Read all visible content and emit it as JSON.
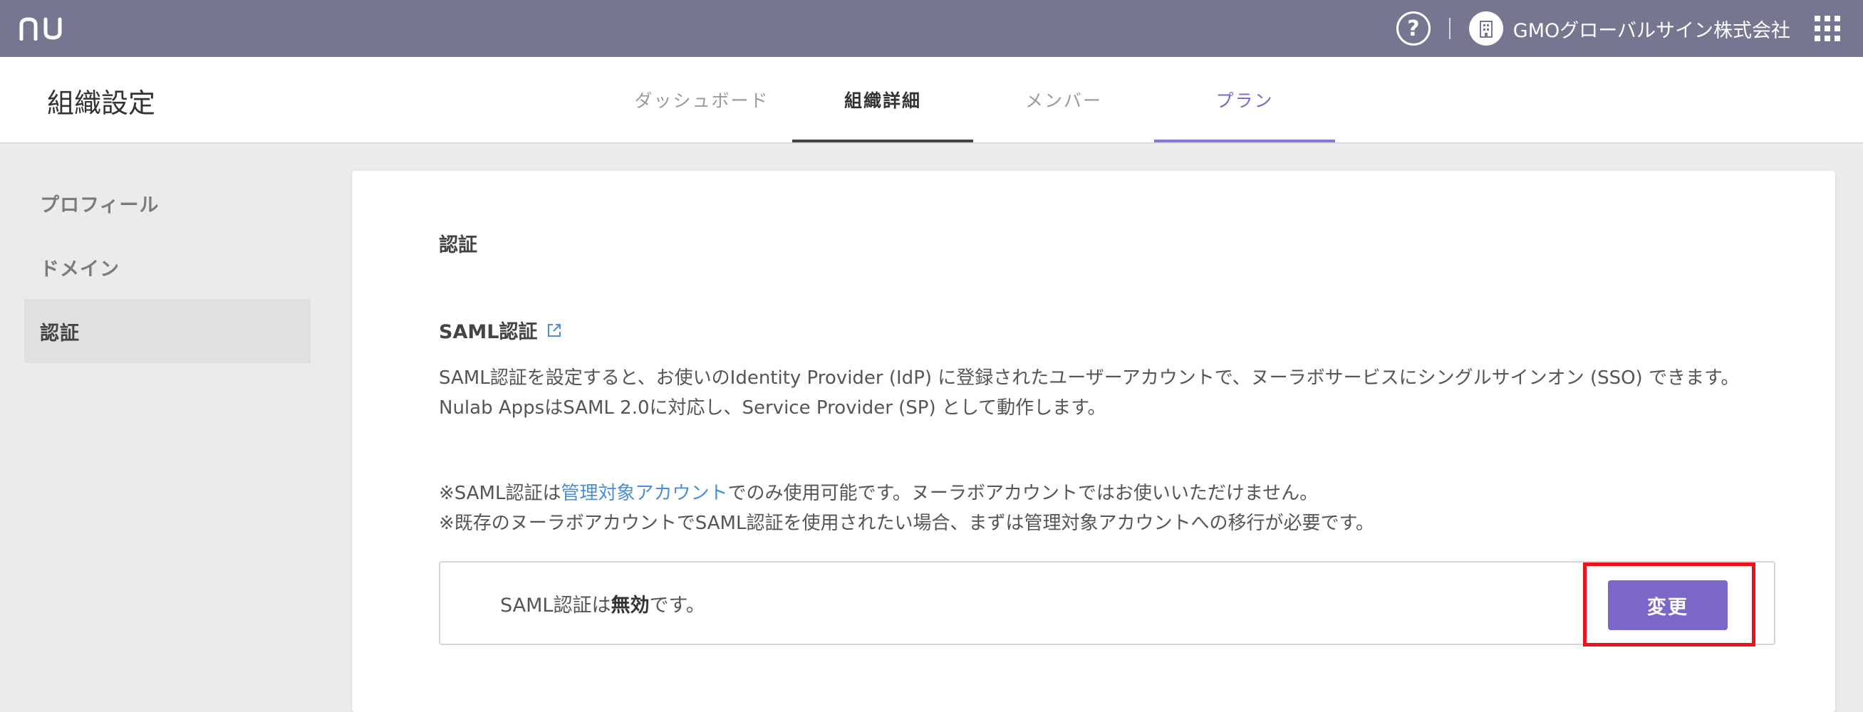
{
  "topbar": {
    "logo_text": "nu",
    "help_label": "?",
    "org_name": "GMOグローバルサイン株式会社",
    "apps_icon": "grid-apps-icon"
  },
  "subheader": {
    "page_title": "組織設定",
    "tabs": [
      {
        "label": "ダッシュボード",
        "state": "normal"
      },
      {
        "label": "組織詳細",
        "state": "active"
      },
      {
        "label": "メンバー",
        "state": "normal"
      },
      {
        "label": "プラン",
        "state": "accent"
      }
    ]
  },
  "sidebar": {
    "items": [
      {
        "label": "プロフィール"
      },
      {
        "label": "ドメイン"
      },
      {
        "label": "認証",
        "selected": true
      }
    ]
  },
  "main": {
    "section_title": "認証",
    "saml_title": "SAML認証",
    "desc_line1": "SAML認証を設定すると、お使いのIdentity Provider (IdP) に登録されたユーザーアカウントで、ヌーラボサービスにシングルサインオン (SSO) できます。",
    "desc_line2": "Nulab AppsはSAML 2.0に対応し、Service Provider (SP) として動作します。",
    "note1_prefix": "※SAML認証は",
    "note1_link": "管理対象アカウント",
    "note1_suffix": "でのみ使用可能です。ヌーラボアカウントではお使いいただけません。",
    "note2": "※既存のヌーラボアカウントでSAML認証を使用されたい場合、まずは管理対象アカウントへの移行が必要です。",
    "status_prefix": "SAML認証は",
    "status_value": "無効",
    "status_suffix": "です。",
    "change_button": "変更"
  },
  "colors": {
    "topbar": "#757690",
    "accent": "#7a67c8",
    "link": "#4a8fd8",
    "highlight": "#e8131b"
  }
}
